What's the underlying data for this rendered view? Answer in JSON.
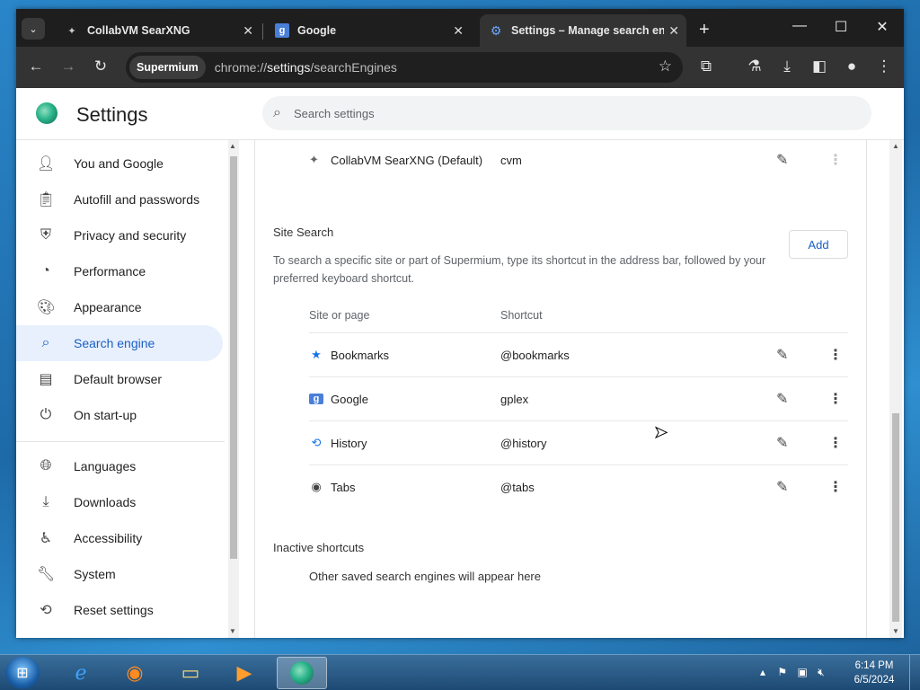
{
  "tabs": [
    {
      "label": "CollabVM SearXNG",
      "icon": "puzzle-icon"
    },
    {
      "label": "Google",
      "icon": "google-icon"
    },
    {
      "label": "Settings – Manage search eng",
      "icon": "gear-icon",
      "active": true
    }
  ],
  "toolbar": {
    "site_chip": "Supermium",
    "url_prefix": "chrome://",
    "url_highlight": "settings",
    "url_suffix": "/searchEngines"
  },
  "header": {
    "title": "Settings",
    "search_placeholder": "Search settings"
  },
  "sidebar": {
    "items": [
      {
        "label": "You and Google",
        "icon": "person-icon"
      },
      {
        "label": "Autofill and passwords",
        "icon": "clipboard-icon"
      },
      {
        "label": "Privacy and security",
        "icon": "shield-icon"
      },
      {
        "label": "Performance",
        "icon": "speedometer-icon"
      },
      {
        "label": "Appearance",
        "icon": "palette-icon"
      },
      {
        "label": "Search engine",
        "icon": "search-icon",
        "active": true
      },
      {
        "label": "Default browser",
        "icon": "browser-icon"
      },
      {
        "label": "On start-up",
        "icon": "power-icon"
      },
      {
        "label": "Languages",
        "icon": "globe-icon"
      },
      {
        "label": "Downloads",
        "icon": "download-icon"
      },
      {
        "label": "Accessibility",
        "icon": "accessibility-icon"
      },
      {
        "label": "System",
        "icon": "wrench-icon"
      },
      {
        "label": "Reset settings",
        "icon": "history-icon"
      }
    ]
  },
  "main": {
    "default_engine": {
      "name": "CollabVM SearXNG (Default)",
      "shortcut": "cvm"
    },
    "site_search": {
      "title": "Site Search",
      "description": "To search a specific site or part of Supermium, type its shortcut in the address bar, followed by your preferred keyboard shortcut.",
      "add_label": "Add",
      "col_site": "Site or page",
      "col_shortcut": "Shortcut",
      "rows": [
        {
          "name": "Bookmarks",
          "shortcut": "@bookmarks",
          "icon": "star-icon"
        },
        {
          "name": "Google",
          "shortcut": "gplex",
          "icon": "google-icon"
        },
        {
          "name": "History",
          "shortcut": "@history",
          "icon": "history-icon"
        },
        {
          "name": "Tabs",
          "shortcut": "@tabs",
          "icon": "globe-icon"
        }
      ]
    },
    "inactive": {
      "title": "Inactive shortcuts",
      "description": "Other saved search engines will appear here"
    }
  },
  "taskbar": {
    "time": "6:14 PM",
    "date": "6/5/2024"
  }
}
